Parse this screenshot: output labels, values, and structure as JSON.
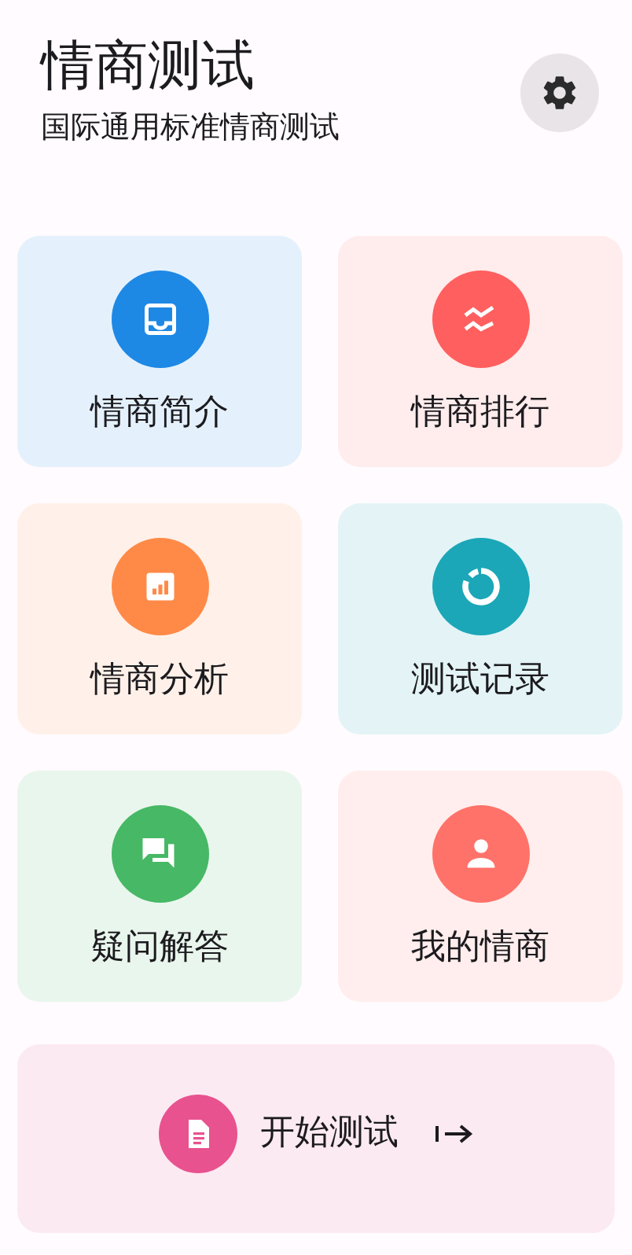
{
  "header": {
    "title": "情商测试",
    "subtitle": "国际通用标准情商测试"
  },
  "tiles": [
    {
      "label": "情商简介",
      "kind": "inbox",
      "color": "#1e88e5"
    },
    {
      "label": "情商排行",
      "kind": "zigzag",
      "color": "#ff5f5f"
    },
    {
      "label": "情商分析",
      "kind": "chart",
      "color": "#ff8a48"
    },
    {
      "label": "测试记录",
      "kind": "ring",
      "color": "#1ba7b7"
    },
    {
      "label": "疑问解答",
      "kind": "chat",
      "color": "#47b865"
    },
    {
      "label": "我的情商",
      "kind": "person",
      "color": "#ff7269"
    }
  ],
  "start": {
    "label": "开始测试",
    "kind": "document",
    "color": "#e8528f"
  }
}
